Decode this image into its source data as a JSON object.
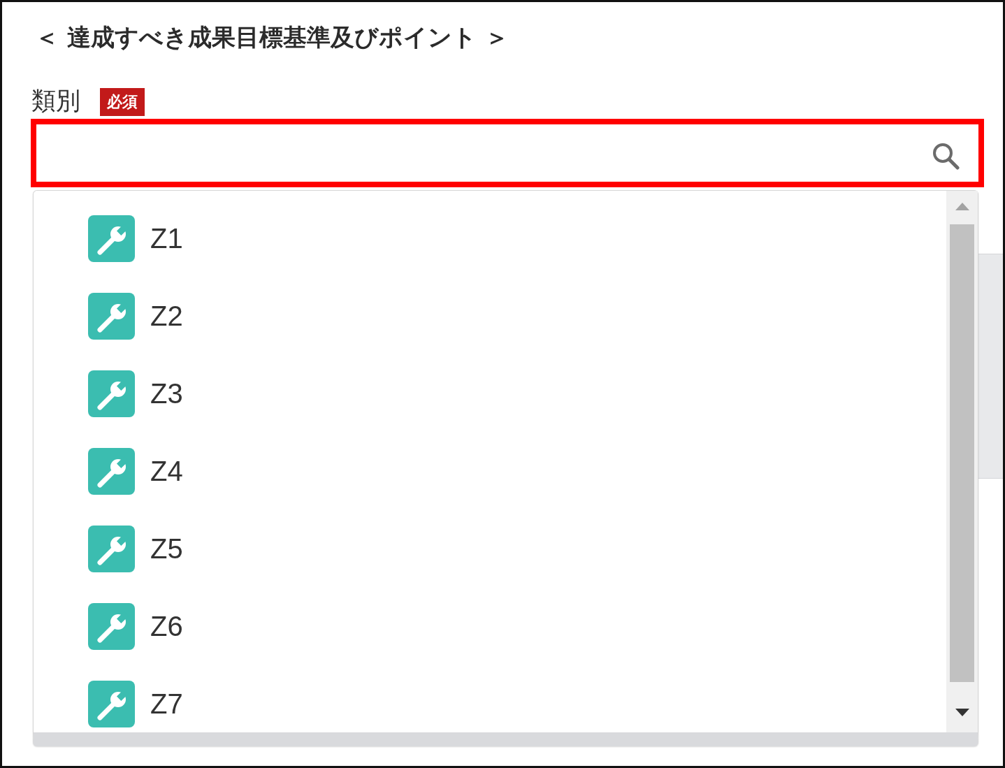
{
  "section_title": "＜ 達成すべき成果目標基準及びポイント ＞",
  "field": {
    "label": "類別",
    "required_badge": "必須",
    "highlighted": true
  },
  "dropdown": {
    "options": [
      {
        "label": "Z1",
        "selected": false
      },
      {
        "label": "Z2",
        "selected": false
      },
      {
        "label": "Z3",
        "selected": false
      },
      {
        "label": "Z4",
        "selected": false
      },
      {
        "label": "Z5",
        "selected": false
      },
      {
        "label": "Z6",
        "selected": false
      },
      {
        "label": "Z7",
        "selected": false
      }
    ]
  }
}
